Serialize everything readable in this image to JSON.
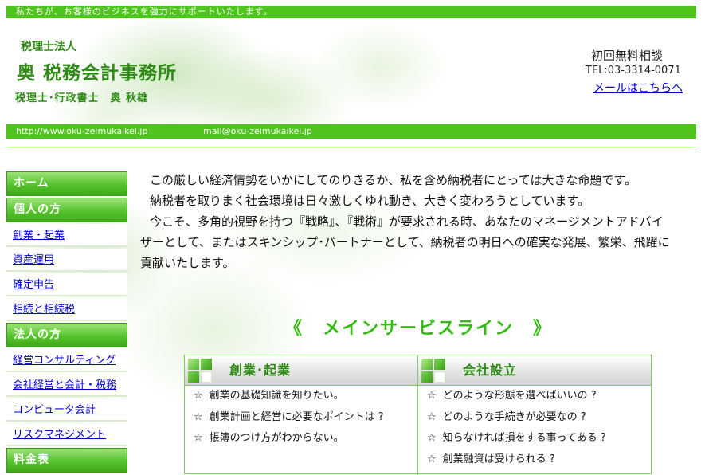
{
  "banner": {
    "tagline": "私たちが、お客様のビジネスを強力にサポートいたします。"
  },
  "header": {
    "corp_type": "税理士法人",
    "firm_name": "奥 税務会計事務所",
    "person": "税理士･行政書士　奥 秋雄"
  },
  "contact": {
    "free_consult": "初回無料相談",
    "tel": "TEL:03-3314-0071",
    "mail_link": "メールはこちらへ"
  },
  "url_bar": {
    "url": "http://www.oku-zeimukaikei.jp",
    "mail": "mail@oku-zeimukaikei.jp"
  },
  "sidebar": {
    "home": "ホーム",
    "individual_head": "個人の方",
    "individual_items": [
      "創業・起業",
      "資産運用",
      "確定申告",
      "相続と相続税"
    ],
    "corporate_head": "法人の方",
    "corporate_items": [
      "経営コンサルティング",
      "会社経営と会計・税務",
      "コンピュータ会計",
      "リスクマネジメント"
    ],
    "fees_head": "料金表"
  },
  "intro": {
    "p1": "この厳しい経済情勢をいかにしてのりきるか、私を含め納税者にとっては大きな命題です。",
    "p2": "納税者を取りまく社会環境は日々激しくゆれ動き、大きく変わろうとしています。",
    "p3a": "今こそ、多角的視野を持つ『戦略』、『戦術』が要求される時、あなたのマネージメントアドバイ",
    "p3b": "ザーとして、またはスキンシップ･パートナーとして、納税者の明日への確実な発展、繁栄、飛躍に",
    "p3c": "貢献いたします。"
  },
  "services": {
    "title": "《　メインサービスライン　》",
    "columns": [
      {
        "label": "創業･起業",
        "questions": [
          "創業の基礎知識を知りたい。",
          "創業計画と経営に必要なポイントは ?",
          "帳簿のつけ方がわからない。"
        ]
      },
      {
        "label": "会社設立",
        "questions": [
          "どのような形態を選べばいいの ?",
          "どのような手続きが必要なの ?",
          "知らなければ損をする事ってある ?",
          "創業融資は受けられる ?"
        ]
      }
    ],
    "star": "☆"
  },
  "colors": {
    "accent_green": "#4fc41f",
    "title_green": "#33bb11",
    "link_blue": "#0000cc"
  }
}
